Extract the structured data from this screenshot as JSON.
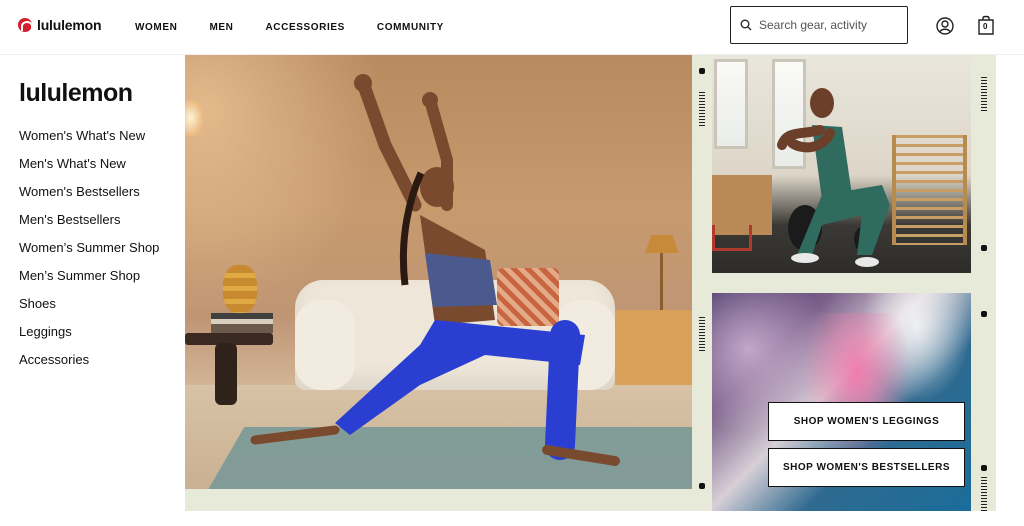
{
  "header": {
    "logo_text": "lululemon",
    "nav": [
      "WOMEN",
      "MEN",
      "ACCESSORIES",
      "COMMUNITY"
    ],
    "search_placeholder": "Search gear, activity",
    "bag_count": "0"
  },
  "sidebar": {
    "title": "lululemon",
    "items": [
      "Women's What's New",
      "Men's What's New",
      "Women's Bestsellers",
      "Men's Bestsellers",
      "Women’s Summer Shop",
      "Men’s Summer Shop",
      "Shoes",
      "Leggings",
      "Accessories"
    ]
  },
  "hero": {
    "cta_leggings": "SHOP WOMEN'S LEGGINGS",
    "cta_bestsellers": "SHOP WOMEN'S BESTSELLERS"
  },
  "colors": {
    "brand_red": "#d22030",
    "hero_background": "#e7ead8",
    "legging_blue": "#2a3fd1"
  }
}
